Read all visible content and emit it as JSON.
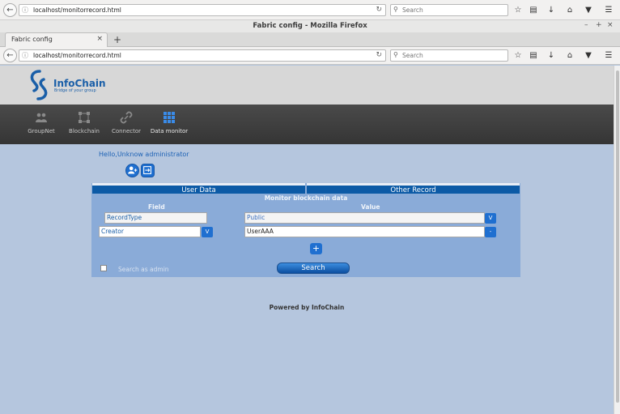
{
  "browser": {
    "ghost_url": "localhost/monitorrecord.html",
    "ghost_search_placeholder": "Search",
    "window_title": "Fabric config - Mozilla Firefox",
    "tab_title": "Fabric config",
    "url_host": "localhost",
    "url_path": "/monitorrecord.html",
    "search_placeholder": "Search"
  },
  "site": {
    "logo_name": "InfoChain",
    "logo_tagline": "Bridge of your group",
    "nav": [
      {
        "label": "GroupNet"
      },
      {
        "label": "Blockchain"
      },
      {
        "label": "Connector"
      },
      {
        "label": "Data monitor"
      }
    ],
    "greeting": "Hello,Unknow administrator"
  },
  "monitor": {
    "tabs": [
      {
        "label": "User Data"
      },
      {
        "label": "Other Record"
      }
    ],
    "title": "Monitor blockchain data",
    "field_header": "Field",
    "value_header": "Value",
    "rows": [
      {
        "field": "RecordType",
        "value": "Public",
        "button": "V"
      },
      {
        "field": "Creator",
        "field_button": "V",
        "value": "UserAAA",
        "button": "-"
      }
    ],
    "add_label": "+",
    "admin_checkbox_label": "Search as admin",
    "search_button": "Search"
  },
  "footer": "Powered by InfoChain",
  "colors": {
    "accent": "#1f6fd0",
    "tab_header": "#0c5aa6",
    "panel_bg": "#8aabd8",
    "page_bg": "#b5c6de",
    "nav_bg": "#3d3d3d"
  }
}
